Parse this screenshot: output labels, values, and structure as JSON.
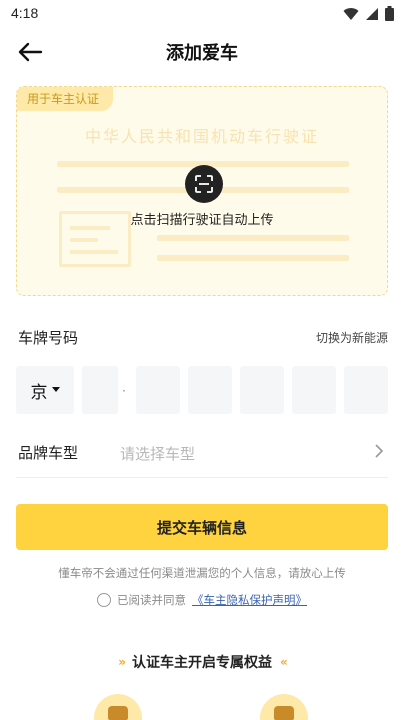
{
  "status_bar": {
    "time": "4:18",
    "icons": [
      "wifi-icon",
      "signal-icon",
      "battery-icon"
    ]
  },
  "header": {
    "title": "添加爱车",
    "back_icon": "arrow-left-icon"
  },
  "scan_card": {
    "tag": "用于车主认证",
    "license_title": "中华人民共和国机动车行驶证",
    "action_text": "点击扫描行驶证自动上传",
    "icon": "scan-icon"
  },
  "plate": {
    "label": "车牌号码",
    "switch_label": "切换为新能源",
    "province_value": "京",
    "separator": "·",
    "cells": [
      "",
      "",
      "",
      "",
      "",
      "",
      ""
    ]
  },
  "brand": {
    "label": "品牌车型",
    "placeholder": "请选择车型",
    "chevron_icon": "chevron-right-icon"
  },
  "submit": {
    "label": "提交车辆信息"
  },
  "privacy_note": "懂车帝不会通过任何渠道泄漏您的个人信息，请放心上传",
  "agreement": {
    "prefix": "已阅读并同意",
    "link": "《车主隐私保护声明》"
  },
  "benefits": {
    "chevrons_left": "»",
    "chevrons_right": "«",
    "title": "认证车主开启专属权益"
  },
  "colors": {
    "accent": "#ffd23f",
    "card_bg": "#fffbea",
    "link": "#3a64b0"
  }
}
